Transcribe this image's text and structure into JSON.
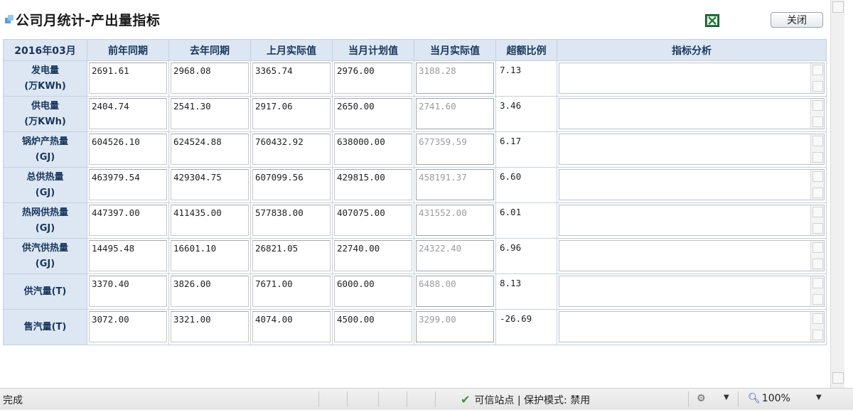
{
  "window": {
    "title": "公司月统计-产出量指标",
    "close_label": "关闭",
    "excel_icon": "excel-export-icon"
  },
  "table": {
    "corner": "2016年03月",
    "columns": [
      "前年同期",
      "去年同期",
      "上月实际值",
      "当月计划值",
      "当月实际值",
      "超额比例",
      "指标分析"
    ],
    "rows": [
      {
        "name": "发电量",
        "unit": "(万KWh)",
        "values": [
          "2691.61",
          "2968.08",
          "3365.74",
          "2976.00",
          "3188.28"
        ],
        "ratio": "7.13",
        "analysis": ""
      },
      {
        "name": "供电量",
        "unit": "(万KWh)",
        "values": [
          "2404.74",
          "2541.30",
          "2917.06",
          "2650.00",
          "2741.60"
        ],
        "ratio": "3.46",
        "analysis": ""
      },
      {
        "name": "锅炉产热量",
        "unit": "(GJ)",
        "values": [
          "604526.10",
          "624524.88",
          "760432.92",
          "638000.00",
          "677359.59"
        ],
        "ratio": "6.17",
        "analysis": ""
      },
      {
        "name": "总供热量",
        "unit": "(GJ)",
        "values": [
          "463979.54",
          "429304.75",
          "607099.56",
          "429815.00",
          "458191.37"
        ],
        "ratio": "6.60",
        "analysis": ""
      },
      {
        "name": "热网供热量",
        "unit": "(GJ)",
        "values": [
          "447397.00",
          "411435.00",
          "577838.00",
          "407075.00",
          "431552.00"
        ],
        "ratio": "6.01",
        "analysis": ""
      },
      {
        "name": "供汽供热量",
        "unit": "(GJ)",
        "values": [
          "14495.48",
          "16601.10",
          "26821.05",
          "22740.00",
          "24322.40"
        ],
        "ratio": "6.96",
        "analysis": ""
      },
      {
        "name": "供汽量(T)",
        "unit": "",
        "values": [
          "3370.40",
          "3826.00",
          "7671.00",
          "6000.00",
          "6488.00"
        ],
        "ratio": "8.13",
        "analysis": ""
      },
      {
        "name": "售汽量(T)",
        "unit": "",
        "values": [
          "3072.00",
          "3321.00",
          "4074.00",
          "4500.00",
          "3299.00"
        ],
        "ratio": "-26.69",
        "analysis": ""
      }
    ]
  },
  "statusbar": {
    "status": "完成",
    "trusted": "可信站点 | 保护模式: 禁用",
    "zoom": "100%"
  },
  "colors": {
    "header_bg": "#dde7f3",
    "header_text": "#17365d",
    "disabled_text": "#9b9b9b"
  }
}
